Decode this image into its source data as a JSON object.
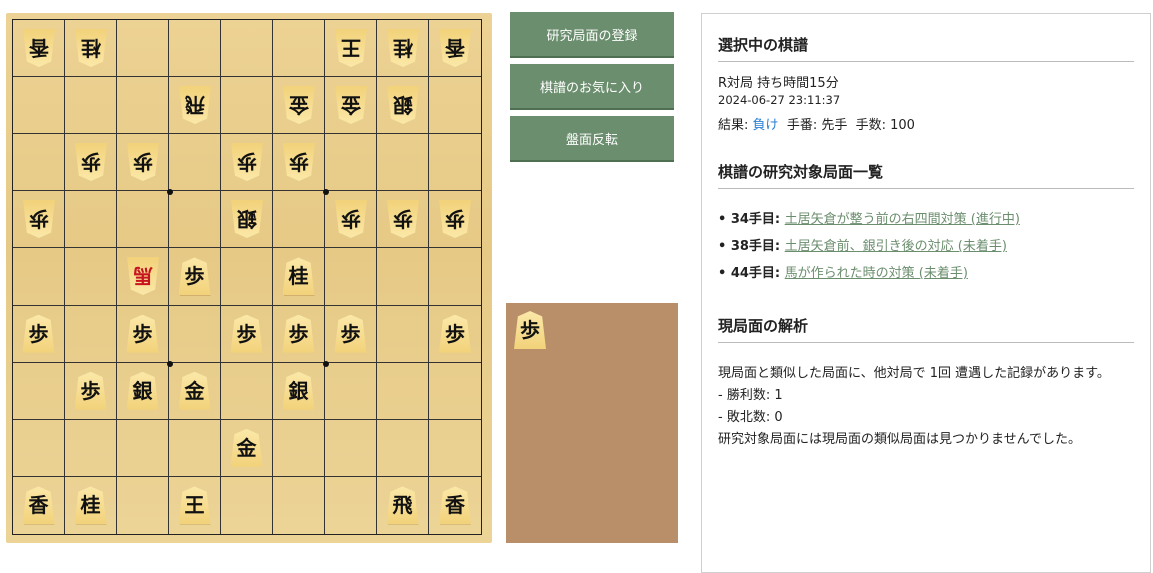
{
  "board": {
    "pieces": [
      [
        {
          "c": "香",
          "g": true
        },
        {
          "c": "桂",
          "g": true
        },
        null,
        null,
        null,
        null,
        {
          "c": "王",
          "g": true
        },
        {
          "c": "桂",
          "g": true
        },
        {
          "c": "香",
          "g": true
        }
      ],
      [
        null,
        null,
        null,
        {
          "c": "飛",
          "g": true
        },
        null,
        {
          "c": "金",
          "g": true
        },
        {
          "c": "金",
          "g": true
        },
        {
          "c": "銀",
          "g": true
        },
        null
      ],
      [
        null,
        {
          "c": "歩",
          "g": true
        },
        {
          "c": "歩",
          "g": true
        },
        null,
        {
          "c": "歩",
          "g": true
        },
        {
          "c": "歩",
          "g": true
        },
        null,
        null,
        null
      ],
      [
        {
          "c": "歩",
          "g": true
        },
        null,
        null,
        null,
        {
          "c": "銀",
          "g": true
        },
        null,
        {
          "c": "歩",
          "g": true
        },
        {
          "c": "歩",
          "g": true
        },
        {
          "c": "歩",
          "g": true
        }
      ],
      [
        null,
        null,
        {
          "c": "馬",
          "g": true,
          "p": true
        },
        {
          "c": "歩"
        },
        null,
        {
          "c": "桂"
        },
        null,
        null,
        null
      ],
      [
        {
          "c": "歩"
        },
        null,
        {
          "c": "歩"
        },
        null,
        {
          "c": "歩"
        },
        {
          "c": "歩"
        },
        {
          "c": "歩"
        },
        null,
        {
          "c": "歩"
        }
      ],
      [
        null,
        {
          "c": "歩"
        },
        {
          "c": "銀"
        },
        {
          "c": "金"
        },
        null,
        {
          "c": "銀"
        },
        null,
        null,
        null
      ],
      [
        null,
        null,
        null,
        null,
        {
          "c": "金"
        },
        null,
        null,
        null,
        null
      ],
      [
        {
          "c": "香"
        },
        {
          "c": "桂"
        },
        null,
        {
          "c": "王"
        },
        null,
        null,
        null,
        {
          "c": "飛"
        },
        {
          "c": "香"
        }
      ]
    ],
    "hand": [
      "歩"
    ]
  },
  "buttons": {
    "register": "研究局面の登録",
    "favorite": "棋譜のお気に入り",
    "flip": "盤面反転"
  },
  "selected": {
    "title": "選択中の棋譜",
    "name": "R対局 持ち時間15分",
    "datetime": "2024-06-27 23:11:37",
    "result_label": "結果:",
    "result_value": "負け",
    "turn": "手番: 先手",
    "moves": "手数: 100"
  },
  "research": {
    "title": "棋譜の研究対象局面一覧",
    "items": [
      {
        "move": "34手目:",
        "text": "土居矢倉が整う前の右四間対策 (進行中)"
      },
      {
        "move": "38手目:",
        "text": "土居矢倉前、銀引き後の対応 (未着手)"
      },
      {
        "move": "44手目:",
        "text": "馬が作られた時の対策 (未着手)"
      }
    ]
  },
  "analysis": {
    "title": "現局面の解析",
    "line1": "現局面と類似した局面に、他対局で 1回 遭遇した記録があります。",
    "wins": "- 勝利数: 1",
    "losses": "- 敗北数: 0",
    "line4": "研究対象局面には現局面の類似局面は見つかりませんでした。"
  }
}
